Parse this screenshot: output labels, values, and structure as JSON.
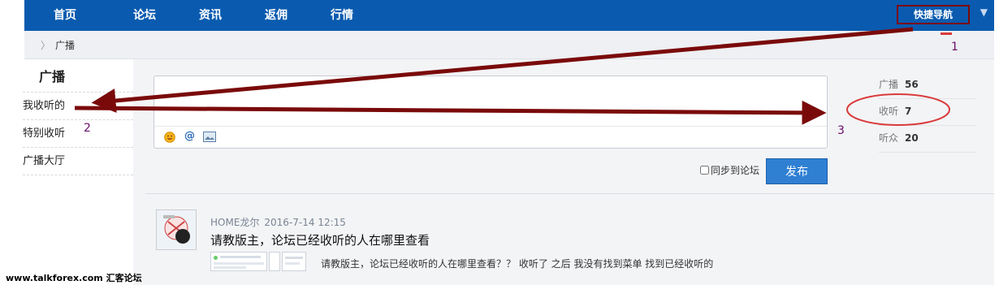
{
  "nav": {
    "items": [
      "首页",
      "论坛",
      "资讯",
      "返佣",
      "行情"
    ],
    "quick_nav_label": "快捷导航",
    "quick_nav_caret": "▼"
  },
  "breadcrumb": {
    "separator": "〉",
    "current": "广播"
  },
  "sidebar": {
    "title": "广播",
    "items": [
      "我收听的",
      "特别收听",
      "广播大厅"
    ]
  },
  "composer": {
    "toolbar_icons": [
      "smiley-icon",
      "at-icon",
      "image-icon"
    ],
    "at_glyph": "@",
    "sync_label": "同步到论坛",
    "post_button": "发布"
  },
  "stats": [
    {
      "label": "广播",
      "value": "56"
    },
    {
      "label": "收听",
      "value": "7"
    },
    {
      "label": "听众",
      "value": "20"
    }
  ],
  "feed": {
    "author": "HOME龙尔",
    "time": "2016-7-14 12:15",
    "title": "请教版主，论坛已经收听的人在哪里查看",
    "excerpt": "请教版主，论坛已经收听的人在哪里查看？？ 收听了 之后 我没有找到菜单 找到已经收听的"
  },
  "annotations": {
    "labels": [
      "1",
      "2",
      "3"
    ],
    "color": "#7a0a0a"
  },
  "watermark": "www.talkforex.com 汇客论坛",
  "colors": {
    "nav_bg": "#0a5baf",
    "button_bg": "#2f7fd3",
    "annotation": "#7a0a0a"
  }
}
